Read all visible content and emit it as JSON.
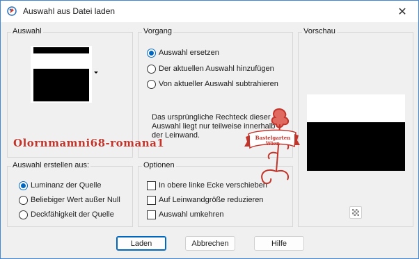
{
  "window": {
    "title": "Auswahl aus Datei laden",
    "close_label": "✕"
  },
  "auswahl_group": {
    "label": "Auswahl"
  },
  "vorgang_group": {
    "label": "Vorgang",
    "options": [
      {
        "label": "Auswahl ersetzen",
        "checked": true
      },
      {
        "label": "Der aktuellen Auswahl hinzufügen",
        "checked": false
      },
      {
        "label": "Von aktueller Auswahl subtrahieren",
        "checked": false
      }
    ],
    "info_text": "Das ursprüngliche Rechteck dieser Auswahl liegt nur teilweise innerhalb der Leinwand."
  },
  "vorschau_group": {
    "label": "Vorschau"
  },
  "erstellen_group": {
    "label": "Auswahl erstellen aus:",
    "options": [
      {
        "label": "Luminanz der Quelle",
        "checked": true
      },
      {
        "label": "Beliebiger Wert außer Null",
        "checked": false
      },
      {
        "label": "Deckfähigkeit der Quelle",
        "checked": false
      }
    ]
  },
  "optionen_group": {
    "label": "Optionen",
    "options": [
      {
        "label": "In obere linke Ecke verschieben",
        "checked": false
      },
      {
        "label": "Auf Leinwandgröße reduzieren",
        "checked": false
      },
      {
        "label": "Auswahl umkehren",
        "checked": false
      }
    ]
  },
  "buttons": {
    "laden": "Laden",
    "abbrechen": "Abbrechen",
    "hilfe": "Hilfe"
  },
  "overlay": {
    "watermark_text": "Olornmamni68-romana1",
    "logo_text": "Bastelgarten Wien",
    "logo_color": "#c2332a"
  },
  "colors": {
    "accent": "#0067c0",
    "window_border": "#3f86d6",
    "dialog_bg": "#f0f0f0"
  }
}
